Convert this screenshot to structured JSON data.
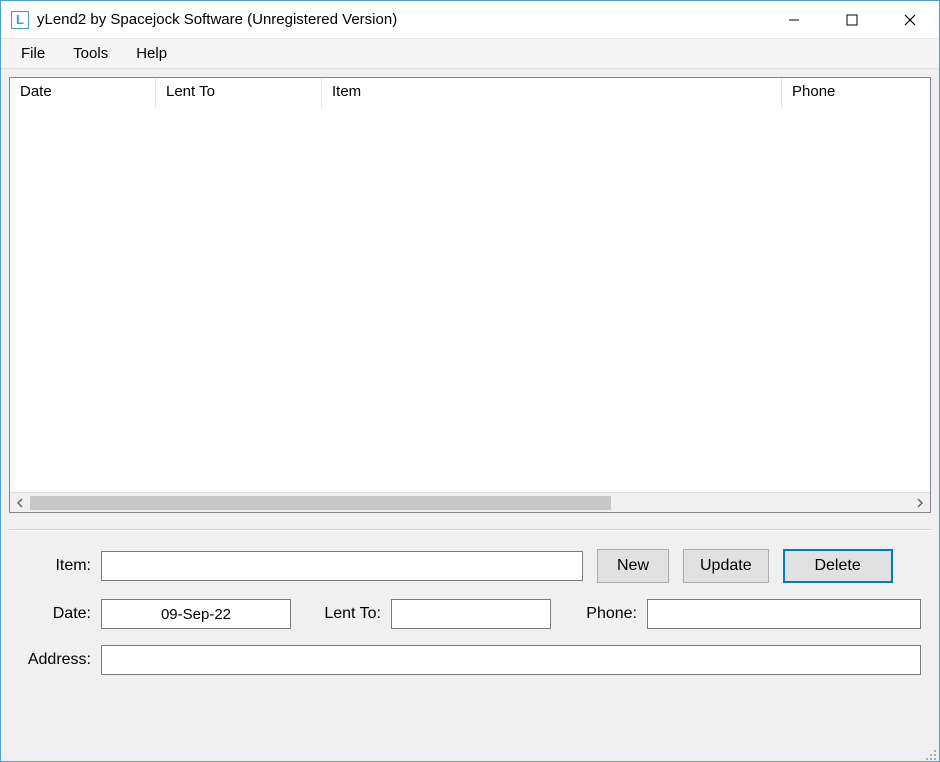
{
  "window": {
    "title": "yLend2 by Spacejock Software (Unregistered Version)",
    "app_icon_letter": "L"
  },
  "menu": {
    "file": "File",
    "tools": "Tools",
    "help": "Help"
  },
  "columns": {
    "date": "Date",
    "lent_to": "Lent To",
    "item": "Item",
    "phone": "Phone"
  },
  "rows": [],
  "form": {
    "labels": {
      "item": "Item:",
      "date": "Date:",
      "lent_to": "Lent To:",
      "phone": "Phone:",
      "address": "Address:"
    },
    "values": {
      "item": "",
      "date": "09-Sep-22",
      "lent_to": "",
      "phone": "",
      "address": ""
    },
    "buttons": {
      "new": "New",
      "update": "Update",
      "delete": "Delete"
    }
  }
}
